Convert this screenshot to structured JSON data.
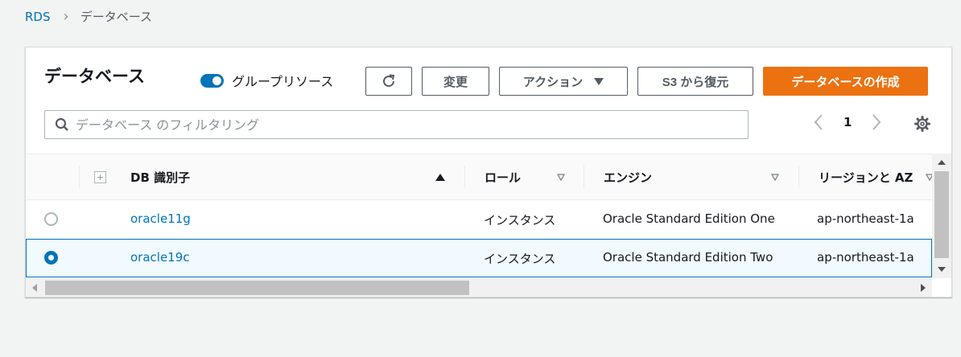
{
  "breadcrumb": {
    "root": "RDS",
    "current": "データベース"
  },
  "panel": {
    "title": "データベース",
    "group_toggle_label": "グループリソース",
    "buttons": {
      "change": "変更",
      "action": "アクション",
      "restore_s3": "S3 から復元",
      "create": "データベースの作成"
    },
    "search_placeholder": "データベース のフィルタリング",
    "page_number": "1"
  },
  "table": {
    "headers": {
      "db_identifier": "DB 識別子",
      "role": "ロール",
      "engine": "エンジン",
      "region_az": "リージョンと AZ"
    },
    "rows": [
      {
        "id": "oracle11g",
        "role": "インスタンス",
        "engine": "Oracle Standard Edition One",
        "region": "ap-northeast-1a",
        "selected": false
      },
      {
        "id": "oracle19c",
        "role": "インスタンス",
        "engine": "Oracle Standard Edition Two",
        "region": "ap-northeast-1a",
        "selected": true
      }
    ]
  },
  "colors": {
    "accent": "#0073bb",
    "primary_button": "#ec7211",
    "selected_row_bg": "#f1faff"
  },
  "icons": {
    "refresh": "refresh-icon",
    "search": "search-icon",
    "settings": "gear-icon",
    "prev": "chevron-left-icon",
    "next": "chevron-right-icon"
  }
}
